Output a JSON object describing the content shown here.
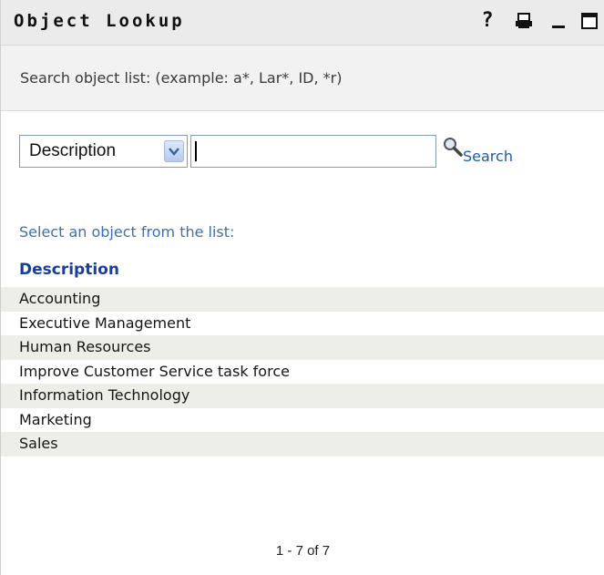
{
  "titlebar": {
    "title": "Object Lookup",
    "icons": [
      "help-icon",
      "print-icon",
      "minimize-icon",
      "maximize-icon"
    ],
    "help_glyph": "?"
  },
  "hint": {
    "text": "Search object list: (example: a*, Lar*, ID, *r)"
  },
  "search": {
    "field_select": {
      "selected": "Description"
    },
    "input_value": "",
    "button_label": "Search"
  },
  "results": {
    "prompt": "Select an object from the list:",
    "column_header": "Description",
    "rows": [
      {
        "label": "Accounting"
      },
      {
        "label": "Executive Management"
      },
      {
        "label": "Human Resources"
      },
      {
        "label": "Improve Customer Service task force"
      },
      {
        "label": "Information Technology"
      },
      {
        "label": "Marketing"
      },
      {
        "label": "Sales"
      }
    ],
    "pager": "1 - 7 of 7"
  },
  "colors": {
    "title_bar_bg": "#ebebeb",
    "hint_bar_bg": "#f2f2f2",
    "row_shade": "#eeeee8",
    "link_blue": "#1f5aa6",
    "header_blue": "#1a3f9a",
    "prompt_blue": "#3c6fb0"
  }
}
